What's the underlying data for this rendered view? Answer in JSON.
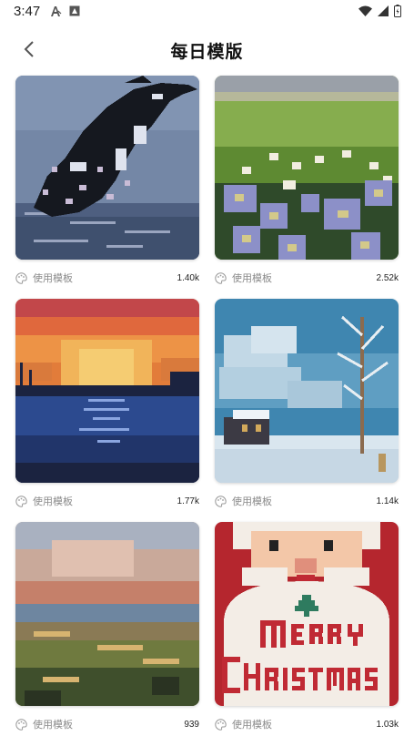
{
  "status_bar": {
    "time": "3:47",
    "left_icons": [
      "text-notification-icon",
      "image-notification-icon"
    ],
    "right_icons": [
      "wifi-icon",
      "signal-icon",
      "battery-icon"
    ]
  },
  "header": {
    "back_icon": "chevron-left-icon",
    "title": "每日模版"
  },
  "templates": [
    {
      "subject": "orca",
      "use_label": "使用模板",
      "count": "1.40k"
    },
    {
      "subject": "daisies",
      "use_label": "使用模板",
      "count": "2.52k"
    },
    {
      "subject": "sunset lake",
      "use_label": "使用模板",
      "count": "1.77k"
    },
    {
      "subject": "snowy cabin",
      "use_label": "使用模板",
      "count": "1.14k"
    },
    {
      "subject": "autumn landscape",
      "use_label": "使用模板",
      "count": "939"
    },
    {
      "subject": "santa",
      "use_label": "使用模板",
      "count": "1.03k",
      "artwork_text": "MERRY CHRISTMAS"
    }
  ]
}
